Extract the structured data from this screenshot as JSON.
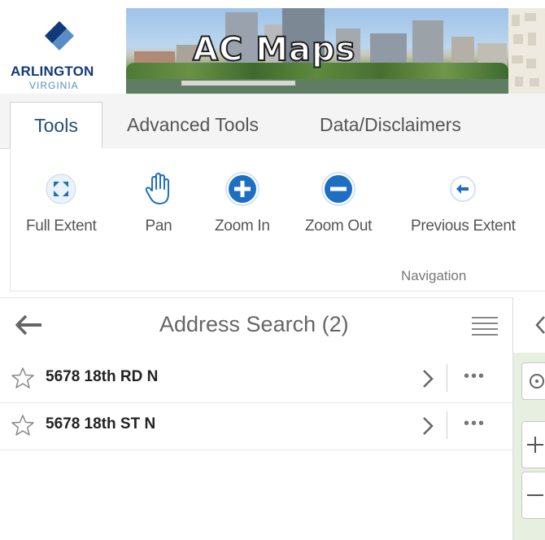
{
  "banner": {
    "org_name": "ARLINGTON",
    "org_state": "VIRGINIA",
    "app_title": "AC Maps"
  },
  "tabs": [
    {
      "label": "Tools",
      "active": true
    },
    {
      "label": "Advanced Tools",
      "active": false
    },
    {
      "label": "Data/Disclaimers",
      "active": false
    }
  ],
  "ribbon": {
    "tools": [
      {
        "label": "Full Extent",
        "icon": "full-extent-icon"
      },
      {
        "label": "Pan",
        "icon": "hand-icon"
      },
      {
        "label": "Zoom In",
        "icon": "zoom-in-icon"
      },
      {
        "label": "Zoom Out",
        "icon": "zoom-out-icon"
      },
      {
        "label": "Previous Extent",
        "icon": "previous-extent-icon"
      }
    ],
    "group_label": "Navigation"
  },
  "results": {
    "title": "Address Search (2)",
    "items": [
      {
        "address": "5678 18th RD N"
      },
      {
        "address": "5678 18th ST N"
      }
    ]
  },
  "colors": {
    "accent_blue": "#1e6fc2",
    "brand_navy": "#123a7a",
    "tab_bar": "#f4f4f4"
  }
}
